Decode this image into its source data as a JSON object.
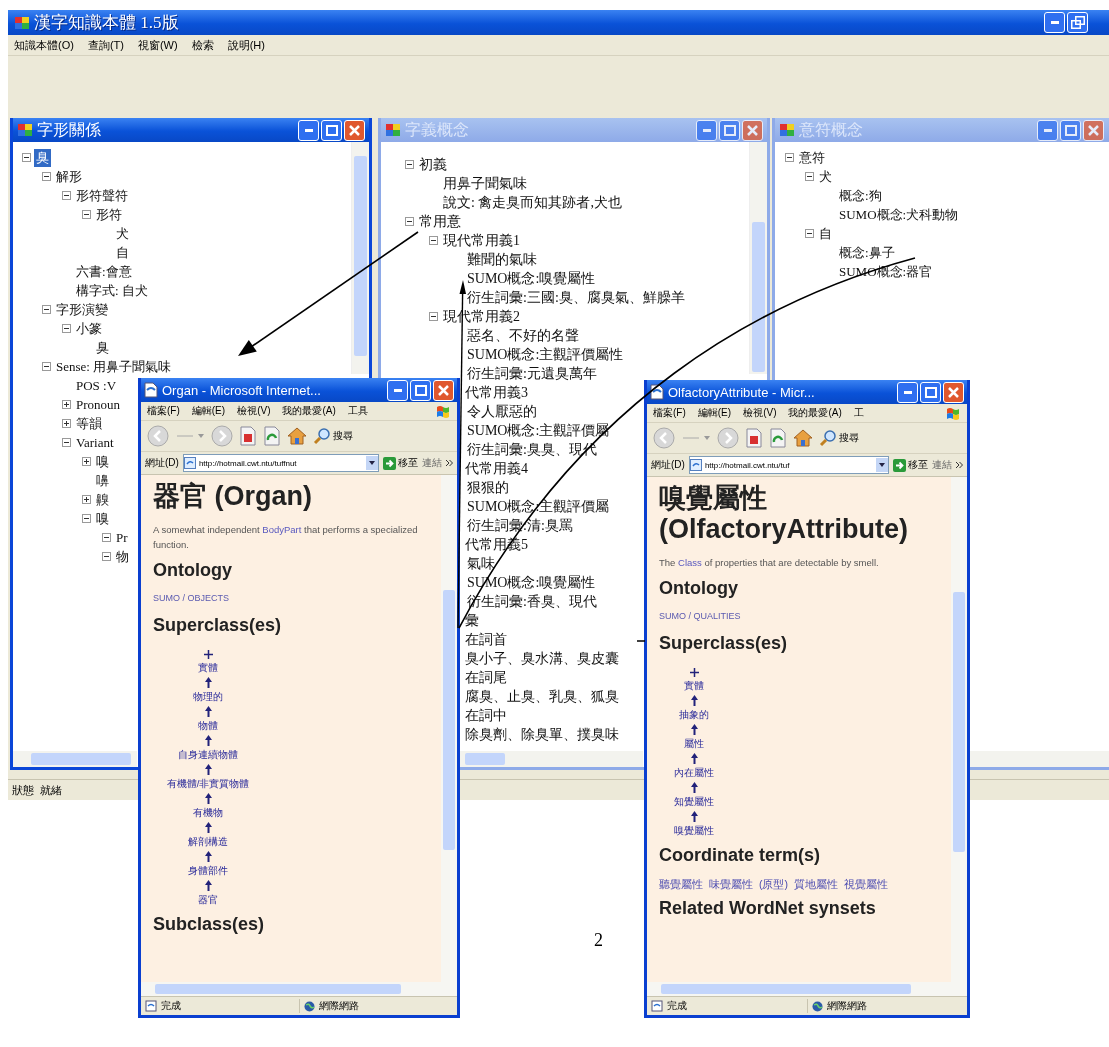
{
  "main_window": {
    "title": "漢字知識本體 1.5版",
    "menu": [
      "知識本體(O)",
      "查詢(T)",
      "視窗(W)",
      "檢索",
      "說明(H)"
    ],
    "status_bar": [
      "狀態",
      "就緒"
    ]
  },
  "child_windows": [
    {
      "title": "字形關係",
      "active": true,
      "tree": [
        {
          "text": "臭",
          "selected": true,
          "expanded": true,
          "children": [
            {
              "text": "解形",
              "selected": false,
              "expanded": true,
              "children": [
                {
                  "text": "形符聲符",
                  "selected": false,
                  "expanded": true,
                  "children": [
                    {
                      "text": "形符",
                      "selected": false,
                      "expanded": true,
                      "children": [
                        {
                          "text": "犬",
                          "selected": false
                        },
                        {
                          "text": "自",
                          "selected": false
                        }
                      ]
                    }
                  ]
                },
                {
                  "text": "六書:會意",
                  "selected": false
                },
                {
                  "text": "構字式: 自犬",
                  "selected": false
                }
              ]
            },
            {
              "text": "字形演變",
              "selected": false,
              "expanded": true,
              "children": [
                {
                  "text": "小篆",
                  "selected": false,
                  "expanded": true,
                  "children": [
                    {
                      "text": "臭",
                      "selected": false
                    }
                  ]
                }
              ]
            },
            {
              "text": "Sense: 用鼻子聞氣味",
              "selected": false,
              "expanded": true,
              "children": [
                {
                  "text": "POS :V",
                  "selected": false
                },
                {
                  "text": "Pronoun",
                  "selected": false,
                  "expanded": false
                },
                {
                  "text": "等韻",
                  "selected": false,
                  "expanded": false
                },
                {
                  "text": "Variant",
                  "selected": false,
                  "expanded": true,
                  "children": [
                    {
                      "text": "嗅",
                      "selected": false,
                      "expanded": false
                    },
                    {
                      "text": "嚊",
                      "selected": false
                    },
                    {
                      "text": "齅",
                      "selected": false,
                      "expanded": false
                    },
                    {
                      "text": "嗅",
                      "selected": false,
                      "expanded": true,
                      "children": [
                        {
                          "text": "Pr",
                          "selected": false,
                          "expanded": true
                        },
                        {
                          "text": "物",
                          "selected": false,
                          "expanded": true
                        }
                      ]
                    }
                  ]
                }
              ]
            }
          ]
        }
      ]
    },
    {
      "title": "字義概念",
      "active": false,
      "tree": [
        {
          "text": "初義",
          "expanded": true,
          "children": [
            {
              "text": "用鼻子聞氣味"
            },
            {
              "text": "說文: 禽走臭而知其跡者,犬也"
            }
          ]
        },
        {
          "text": "常用意",
          "expanded": true,
          "children": [
            {
              "text": "現代常用義1",
              "expanded": true,
              "children": [
                {
                  "text": "難聞的氣味"
                },
                {
                  "text": "SUMO概念:嗅覺屬性"
                },
                {
                  "text": "衍生詞彙:三國:臭、腐臭氣、鮮臊羊"
                }
              ]
            },
            {
              "text": "現代常用義2",
              "expanded": true,
              "children": [
                {
                  "text": "惡名、不好的名聲"
                },
                {
                  "text": "SUMO概念:主觀評價屬性"
                },
                {
                  "text": "衍生詞彙:元遺臭萬年"
                }
              ]
            },
            {
              "text": "代常用義3",
              "cut": true,
              "children": [
                {
                  "text": "令人厭惡的"
                },
                {
                  "text": "SUMO概念:主觀評價屬"
                },
                {
                  "text": "衍生詞彙:臭臭、現代"
                }
              ]
            },
            {
              "text": "代常用義4",
              "cut": true,
              "children": [
                {
                  "text": "狠狠的"
                },
                {
                  "text": "SUMO概念:主觀評價屬"
                },
                {
                  "text": "衍生詞彙:清:臭罵"
                }
              ]
            },
            {
              "text": "代常用義5",
              "cut": true,
              "children": [
                {
                  "text": "氣味"
                },
                {
                  "text": "SUMO概念:嗅覺屬性"
                },
                {
                  "text": "衍生詞彙:香臭、現代"
                }
              ]
            }
          ]
        },
        {
          "text": "彙",
          "cut": true,
          "children": [
            {
              "text": "在詞首",
              "cut": true,
              "children": [
                {
                  "text": "臭小子、臭水溝、臭皮囊",
                  "cut": true
                }
              ]
            },
            {
              "text": "在詞尾",
              "cut": true,
              "children": [
                {
                  "text": "腐臭、止臭、乳臭、狐臭",
                  "cut": true
                }
              ]
            },
            {
              "text": "在詞中",
              "cut": true,
              "children": [
                {
                  "text": "除臭劑、除臭單、撲臭味",
                  "cut": true
                }
              ]
            }
          ]
        }
      ]
    },
    {
      "title": "意符概念",
      "active": false,
      "tree": [
        {
          "text": "意符",
          "expanded": true,
          "children": [
            {
              "text": "犬",
              "expanded": true,
              "children": [
                {
                  "text": "概念:狗"
                },
                {
                  "text": "SUMO概念:犬科動物"
                }
              ]
            },
            {
              "text": "自",
              "expanded": true,
              "children": [
                {
                  "text": "概念:鼻子"
                },
                {
                  "text": "SUMO概念:器官"
                }
              ]
            }
          ]
        }
      ]
    }
  ],
  "browser_windows": [
    {
      "title": "Organ - Microsoft Internet...",
      "menu": [
        "檔案(F)",
        "編輯(E)",
        "檢視(V)",
        "我的最愛(A)",
        "工具"
      ],
      "search": "搜尋",
      "address_label": "網址(D)",
      "address": "http://hotmail.cwt.ntu/tuffnut",
      "go": "移至",
      "links": "連結",
      "heading": "器官 (Organ)",
      "definition": [
        {
          "text": "A somewhat independent "
        },
        {
          "text": "BodyPart",
          "link": true
        },
        {
          "text": " that performs a specialized function."
        }
      ],
      "sections": [
        {
          "kind": "heading",
          "text": "Ontology"
        },
        {
          "kind": "link",
          "text": "SUMO / OBJECTS"
        },
        {
          "kind": "heading",
          "text": "Superclass(es)"
        },
        {
          "kind": "chain",
          "items": [
            "實體",
            "物理的",
            "物體",
            "自身連續物體",
            "有機體/非實質物體",
            "有機物",
            "解剖構造",
            "身體部件",
            "器官"
          ]
        },
        {
          "kind": "heading",
          "text": "Subclass(es)"
        }
      ],
      "status": "完成",
      "zone": "網際網路"
    },
    {
      "title": "OlfactoryAttribute - Micr...",
      "menu": [
        "檔案(F)",
        "編輯(E)",
        "檢視(V)",
        "我的最愛(A)",
        "工"
      ],
      "search": "搜尋",
      "address_label": "網址(D)",
      "address": "http://hotmail.cwt.ntu/tuf",
      "go": "移至",
      "links": "連結",
      "heading": "嗅覺屬性 (OlfactoryAttribute)",
      "definition": [
        {
          "text": "The "
        },
        {
          "text": "Class",
          "link": true
        },
        {
          "text": " of properties that are detectable by smell."
        }
      ],
      "sections": [
        {
          "kind": "heading",
          "text": "Ontology"
        },
        {
          "kind": "link",
          "text": "SUMO / QUALITIES"
        },
        {
          "kind": "heading",
          "text": "Superclass(es)"
        },
        {
          "kind": "chain",
          "items": [
            "實體",
            "抽象的",
            "屬性",
            "內在屬性",
            "知覺屬性",
            "嗅覺屬性"
          ]
        },
        {
          "kind": "heading",
          "text": "Coordinate term(s)"
        },
        {
          "kind": "links",
          "items": [
            "聽覺屬性",
            "味覺屬性",
            "(原型)",
            "質地屬性",
            "視覺屬性"
          ]
        },
        {
          "kind": "heading",
          "text": "Related WordNet synsets"
        }
      ],
      "status": "完成",
      "zone": "網際網路"
    }
  ],
  "page_number": "2"
}
